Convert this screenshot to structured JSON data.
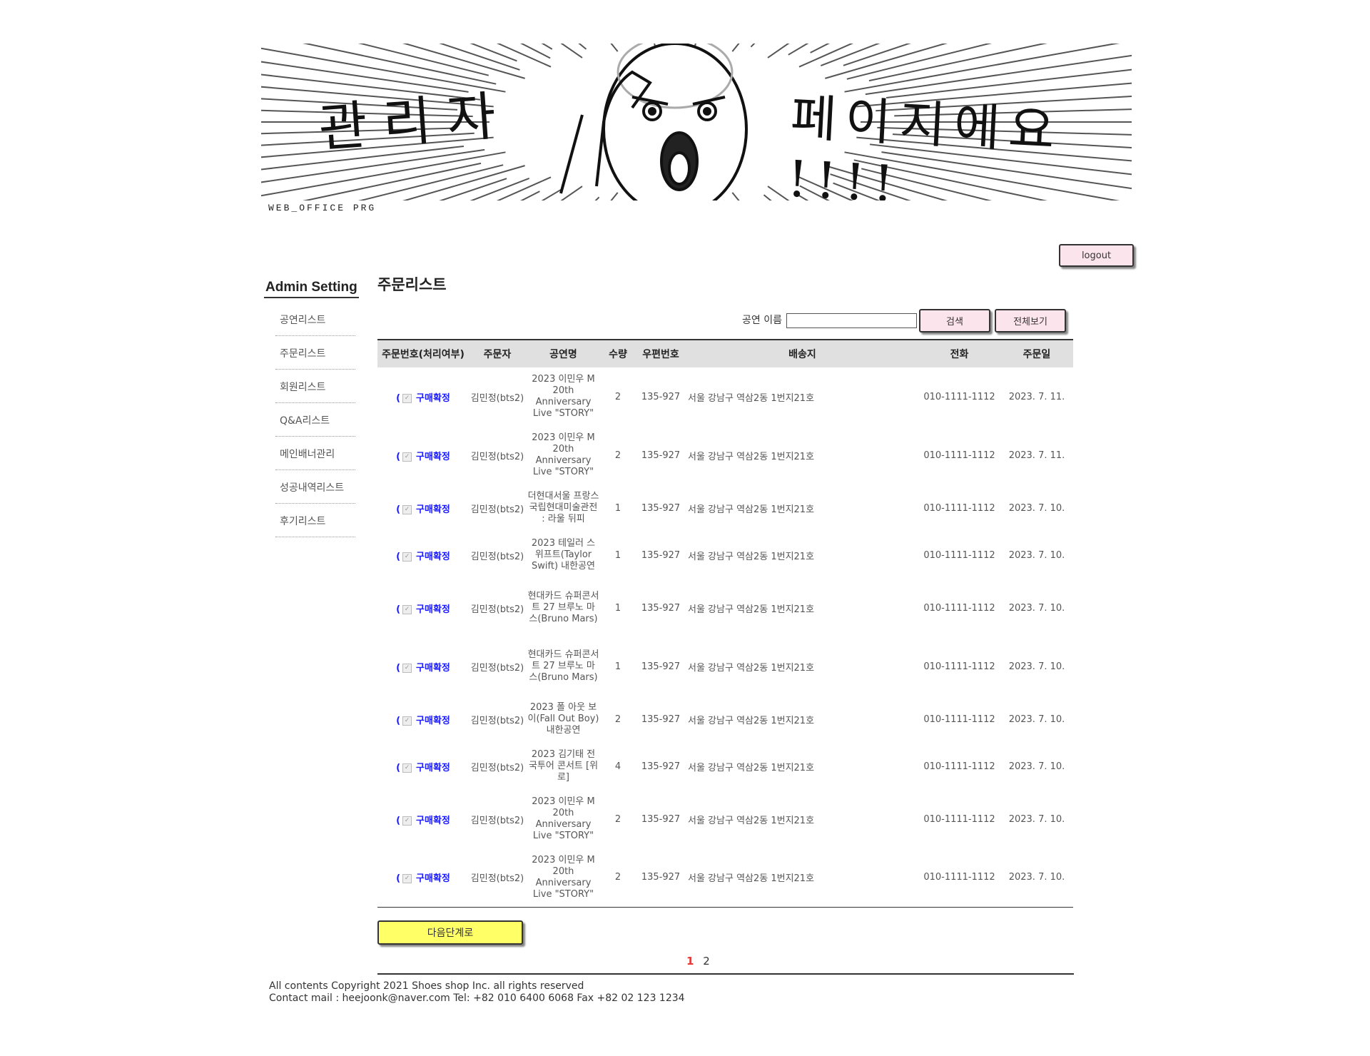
{
  "banner": {
    "left_text": "관리자",
    "right_text": "페이지에요 !!!!",
    "logo": "WEB_OFFICE PRG"
  },
  "header": {
    "logout_label": "logout"
  },
  "sidebar": {
    "title": "Admin Setting",
    "items": [
      {
        "label": "공연리스트"
      },
      {
        "label": "주문리스트"
      },
      {
        "label": "회원리스트"
      },
      {
        "label": "Q&A리스트"
      },
      {
        "label": "메인배너관리"
      },
      {
        "label": "성공내역리스트"
      },
      {
        "label": "후기리스트"
      }
    ]
  },
  "main": {
    "title": "주문리스트",
    "search": {
      "label": "공연 이름",
      "value": "",
      "search_label": "검색",
      "view_all_label": "전체보기"
    },
    "columns": [
      "주문번호(처리여부)",
      "주문자",
      "공연명",
      "수량",
      "우편번호",
      "배송지",
      "전화",
      "주문일"
    ],
    "rows": [
      {
        "status": "구매확정",
        "customer": "김민정(bts2)",
        "show": "2023 이민우 M 20th Anniversary Live \"STORY\"",
        "qty": "2",
        "zip": "135-927",
        "address": "서울 강남구 역삼2동 1번지21호",
        "phone": "010-1111-1112",
        "date": "2023. 7. 11."
      },
      {
        "status": "구매확정",
        "customer": "김민정(bts2)",
        "show": "2023 이민우 M 20th Anniversary Live \"STORY\"",
        "qty": "2",
        "zip": "135-927",
        "address": "서울 강남구 역삼2동 1번지21호",
        "phone": "010-1111-1112",
        "date": "2023. 7. 11."
      },
      {
        "status": "구매확정",
        "customer": "김민정(bts2)",
        "show": "더현대서울 프랑스국립현대미술관전 : 라울 뒤피",
        "qty": "1",
        "zip": "135-927",
        "address": "서울 강남구 역삼2동 1번지21호",
        "phone": "010-1111-1112",
        "date": "2023. 7. 10."
      },
      {
        "status": "구매확정",
        "customer": "김민정(bts2)",
        "show": "2023 테일러 스위프트(Taylor Swift) 내한공연",
        "qty": "1",
        "zip": "135-927",
        "address": "서울 강남구 역삼2동 1번지21호",
        "phone": "010-1111-1112",
        "date": "2023. 7. 10."
      },
      {
        "status": "구매확정",
        "customer": "김민정(bts2)",
        "show": "현대카드 슈퍼콘서트 27 브루노 마스(Bruno Mars)",
        "qty": "1",
        "zip": "135-927",
        "address": "서울 강남구 역삼2동 1번지21호",
        "phone": "010-1111-1112",
        "date": "2023. 7. 10."
      },
      {
        "status": "구매확정",
        "customer": "김민정(bts2)",
        "show": "현대카드 슈퍼콘서트 27 브루노 마스(Bruno Mars)",
        "qty": "1",
        "zip": "135-927",
        "address": "서울 강남구 역삼2동 1번지21호",
        "phone": "010-1111-1112",
        "date": "2023. 7. 10."
      },
      {
        "status": "구매확정",
        "customer": "김민정(bts2)",
        "show": "2023 폴 아웃 보이(Fall Out Boy) 내한공연",
        "qty": "2",
        "zip": "135-927",
        "address": "서울 강남구 역삼2동 1번지21호",
        "phone": "010-1111-1112",
        "date": "2023. 7. 10."
      },
      {
        "status": "구매확정",
        "customer": "김민정(bts2)",
        "show": "2023 김기태 전국투어 콘서트 [위로]",
        "qty": "4",
        "zip": "135-927",
        "address": "서울 강남구 역삼2동 1번지21호",
        "phone": "010-1111-1112",
        "date": "2023. 7. 10."
      },
      {
        "status": "구매확정",
        "customer": "김민정(bts2)",
        "show": "2023 이민우 M 20th Anniversary Live \"STORY\"",
        "qty": "2",
        "zip": "135-927",
        "address": "서울 강남구 역삼2동 1번지21호",
        "phone": "010-1111-1112",
        "date": "2023. 7. 10."
      },
      {
        "status": "구매확정",
        "customer": "김민정(bts2)",
        "show": "2023 이민우 M 20th Anniversary Live \"STORY\"",
        "qty": "2",
        "zip": "135-927",
        "address": "서울 강남구 역삼2동 1번지21호",
        "phone": "010-1111-1112",
        "date": "2023. 7. 10."
      }
    ],
    "next_step_label": "다음단계로",
    "pages": [
      "1",
      "2"
    ],
    "current_page": "1"
  },
  "footer": {
    "line1": "All contents Copyright 2021 Shoes shop Inc. all rights reserved",
    "line2": "Contact mail : heejoonk@naver.com Tel: +82 010 6400 6068 Fax +82 02 123 1234"
  },
  "colors": {
    "pink_button": "#fce4ec",
    "yellow_button": "#ffff66",
    "status_link": "#1a1aff",
    "active_page": "#e53935"
  }
}
